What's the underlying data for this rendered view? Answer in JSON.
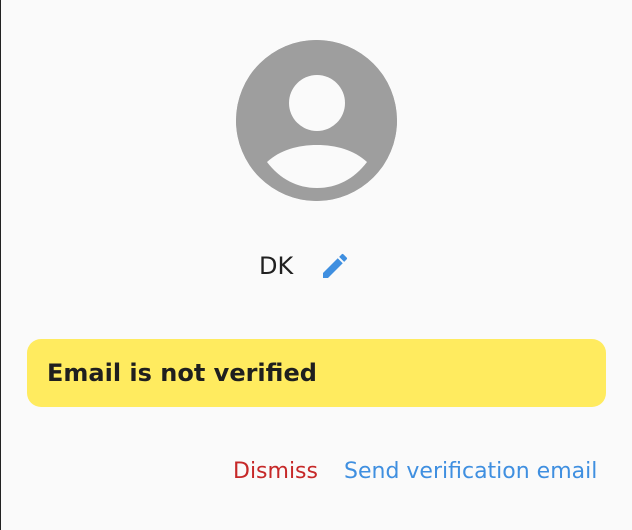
{
  "profile": {
    "display_name": "DK",
    "avatar_icon": "person-silhouette-icon",
    "edit_icon": "pencil-edit-icon"
  },
  "banner": {
    "message": "Email is not verified",
    "background_color": "#ffeb5f"
  },
  "actions": {
    "dismiss_label": "Dismiss",
    "send_label": "Send verification email",
    "dismiss_color": "#c62828",
    "send_color": "#3f8fe0"
  }
}
